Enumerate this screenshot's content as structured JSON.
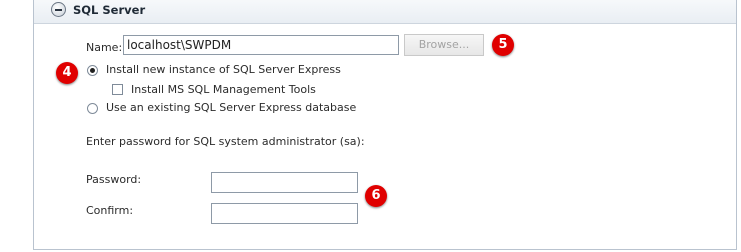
{
  "section": {
    "title": "SQL Server",
    "collapse_icon": "minus-circle-icon"
  },
  "name_row": {
    "label": "Name:",
    "value": "localhost\\SWPDM",
    "browse_label": "Browse..."
  },
  "options": {
    "install_new": "Install new instance of SQL Server Express",
    "install_tools": "Install MS SQL Management Tools",
    "use_existing": "Use an existing SQL Server Express database",
    "selected": "install_new",
    "install_tools_checked": false
  },
  "password_section": {
    "prompt": "Enter password for SQL system administrator (sa):",
    "password_label": "Password:",
    "confirm_label": "Confirm:",
    "password_value": "",
    "confirm_value": ""
  },
  "callouts": [
    "4",
    "5",
    "6"
  ],
  "colors": {
    "callout": "#e00000",
    "panel_border": "#b9c3cf"
  }
}
